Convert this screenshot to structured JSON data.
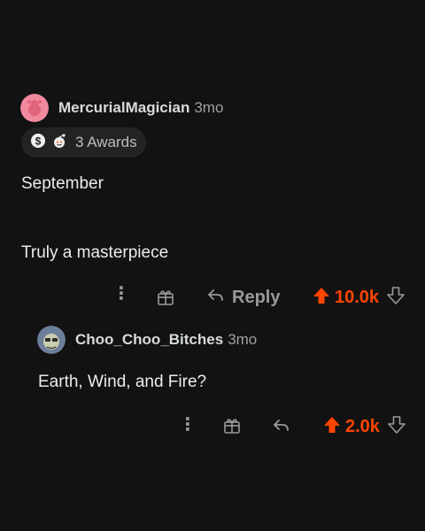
{
  "comment": {
    "username": "MercurialMagician",
    "age": "3mo",
    "awards_label": "3 Awards",
    "paragraphs": [
      "September",
      "Truly a masterpiece"
    ],
    "reply_label": "Reply",
    "score": "10.0k",
    "vote_color": "#ff4500"
  },
  "reply": {
    "username": "Choo_Choo_Bitches",
    "age": "3mo",
    "text": "Earth, Wind, and Fire?",
    "score": "2.0k"
  },
  "icons": {
    "more": "more-options-icon",
    "award": "gift-award-icon",
    "reply": "reply-arrow-icon",
    "upvote": "upvote-arrow-icon",
    "downvote": "downvote-arrow-icon",
    "coin": "coin-award-icon",
    "snoo": "snoo-award-icon"
  }
}
